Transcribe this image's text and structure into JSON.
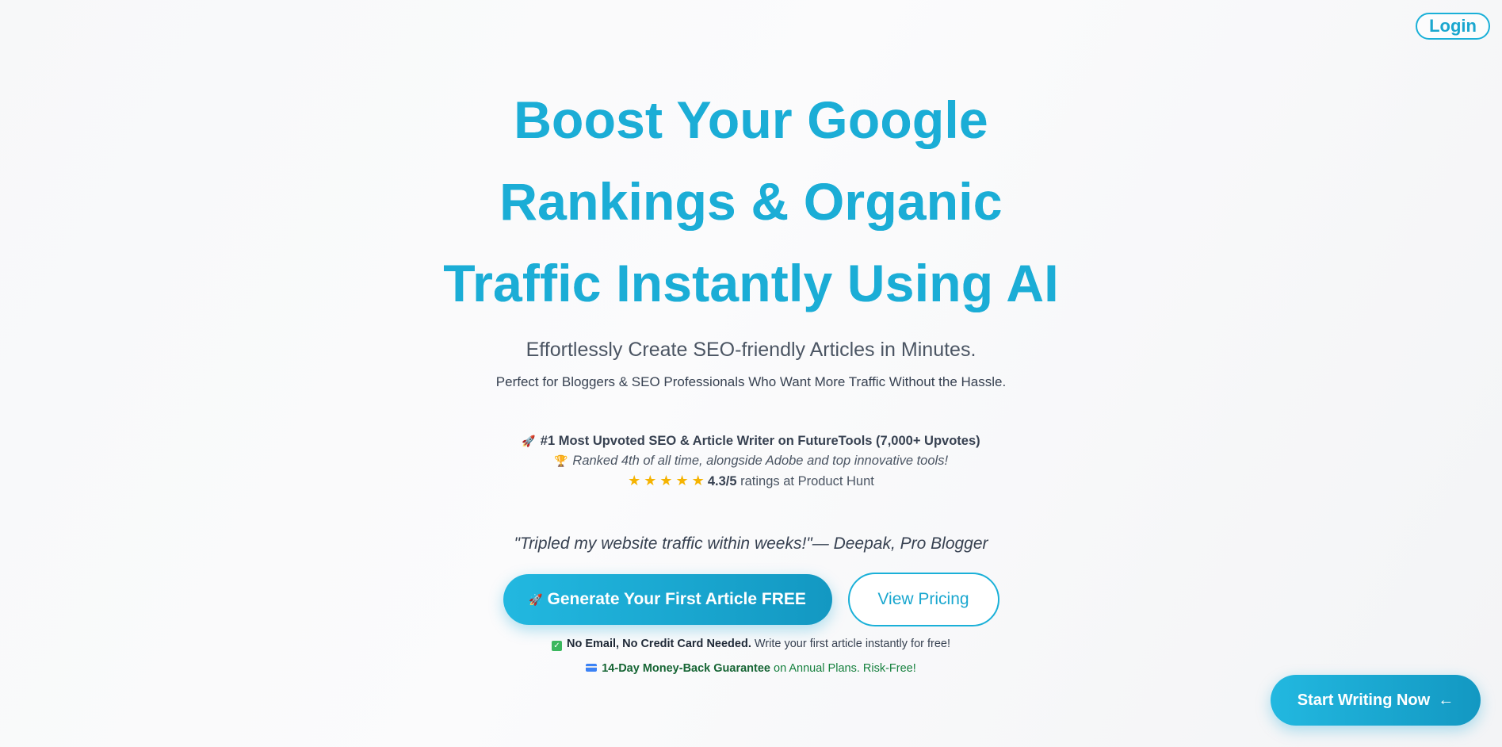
{
  "header": {
    "login_label": "Login"
  },
  "hero": {
    "headline_line1": "Boost Your Google",
    "headline_line2": "Rankings & Organic",
    "headline_line3": "Traffic Instantly Using AI",
    "subline1": "Effortlessly Create SEO-friendly Articles in Minutes.",
    "subline2": "Perfect for Bloggers & SEO Professionals Who Want More Traffic Without the Hassle."
  },
  "social_proof": {
    "rocket_icon": "🚀",
    "line1": "#1 Most Upvoted SEO & Article Writer on FutureTools (7,000+ Upvotes)",
    "trophy_icon": "🏆",
    "line2": "Ranked 4th of all time, alongside Adobe and top innovative tools!",
    "rating_value": "4.3/5",
    "rating_text": "ratings at Product Hunt",
    "star_count": 5
  },
  "testimonial": {
    "quote": "\"Tripled my website traffic within weeks!\"— Deepak, Pro Blogger"
  },
  "cta": {
    "primary_icon": "🚀",
    "primary_label": "Generate Your First Article FREE",
    "secondary_label": "View Pricing"
  },
  "notes": {
    "note1_bold": "No Email, No Credit Card Needed.",
    "note1_text": "Write your first article instantly for free!",
    "note2_bold": "14-Day Money-Back Guarantee",
    "note2_text": "on Annual Plans. Risk-Free!"
  },
  "floating_cta": {
    "label": "Start Writing Now",
    "arrow": "←"
  },
  "colors": {
    "accent": "#1ab0d8",
    "accent_dark": "#1398c2",
    "star": "#f5b301",
    "guarantee_green": "#15803d"
  }
}
